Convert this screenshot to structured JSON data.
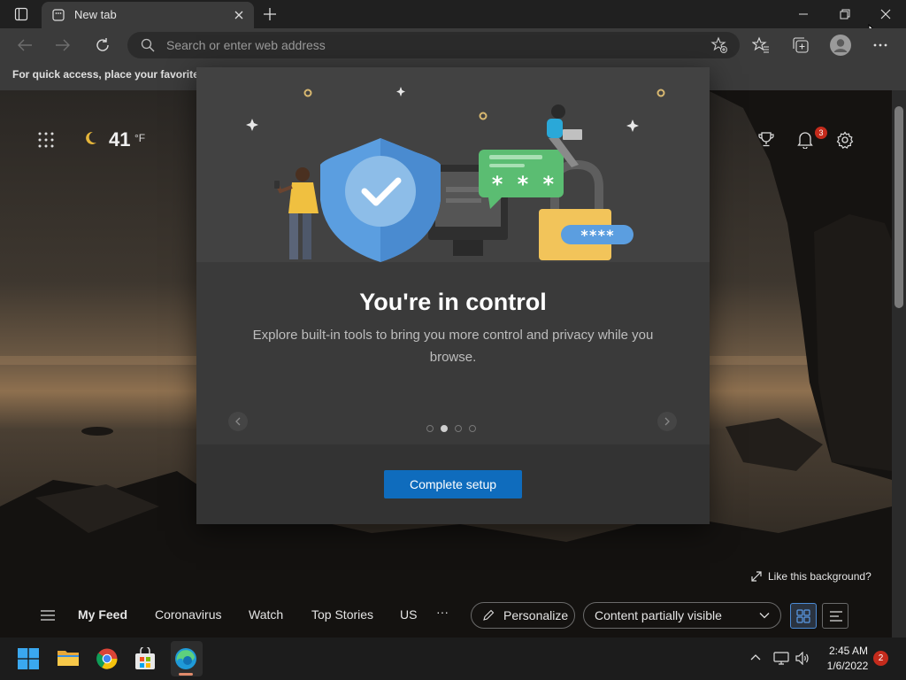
{
  "browser": {
    "tab_title": "New tab",
    "address_placeholder": "Search or enter web address",
    "favorites_bar_text": "For quick access, place your favorites h"
  },
  "ntp": {
    "weather_temp": "41",
    "weather_unit": "°F",
    "notification_count": "3",
    "like_background": "Like this background?"
  },
  "feed": {
    "items": [
      "My Feed",
      "Coronavirus",
      "Watch",
      "Top Stories",
      "US"
    ],
    "more": "···",
    "personalize_label": "Personalize",
    "content_visibility": "Content partially visible"
  },
  "modal": {
    "title": "You're in control",
    "description": "Explore built-in tools to bring you more control and privacy while you browse.",
    "button_label": "Complete setup",
    "dots_total": 4,
    "active_dot": 2,
    "password_bubble": "* * *",
    "password_field": "****"
  },
  "taskbar": {
    "time": "2:45 AM",
    "date": "1/6/2022",
    "notification_count": "2"
  },
  "colors": {
    "accent": "#0f6cbd",
    "badge": "#c42b1c"
  }
}
